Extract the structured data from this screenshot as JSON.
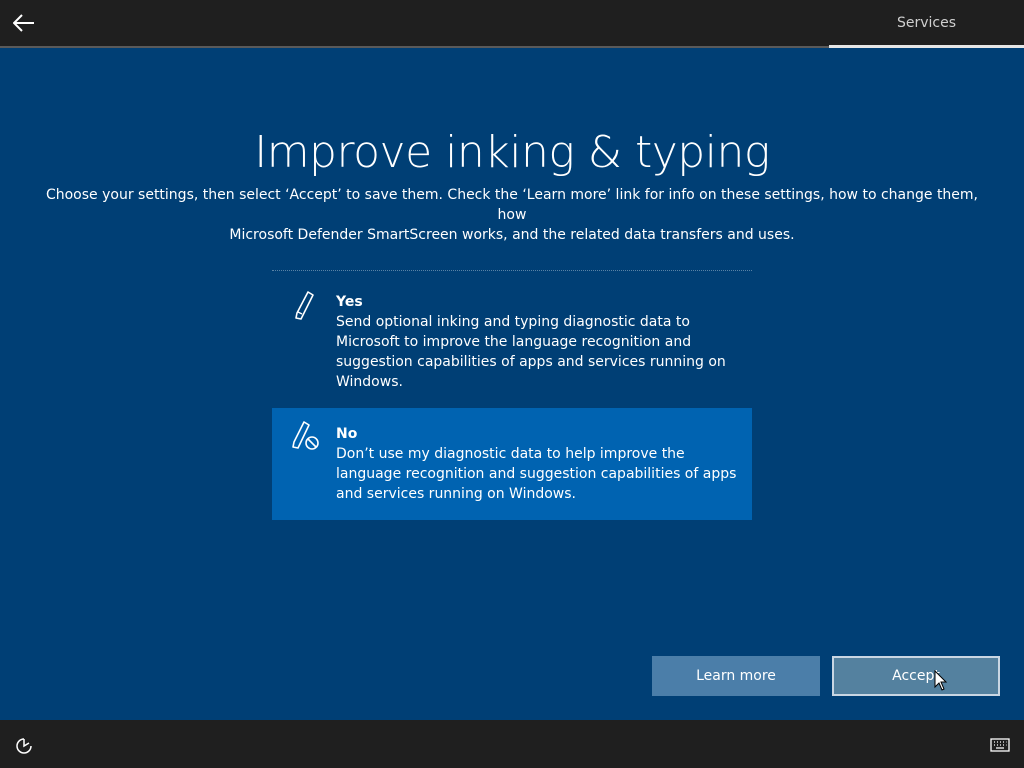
{
  "header": {
    "back_icon": "back-arrow-icon",
    "section": "Services"
  },
  "main": {
    "title": "Improve inking & typing",
    "subtitle_line1": "Choose your settings, then select ‘Accept’ to save them. Check the ‘Learn more’ link for info on these settings, how to change them, how",
    "subtitle_line2": "Microsoft Defender SmartScreen works, and the related data transfers and uses.",
    "options": [
      {
        "icon": "pen-icon",
        "title": "Yes",
        "description": "Send optional inking and typing diagnostic data to Microsoft to improve the language recognition and suggestion capabilities of apps and services running on Windows.",
        "selected": false
      },
      {
        "icon": "pen-blocked-icon",
        "title": "No",
        "description": "Don’t use my diagnostic data to help improve the language recognition and suggestion capabilities of apps and services running on Windows.",
        "selected": true
      }
    ]
  },
  "footer": {
    "learn_more_label": "Learn more",
    "accept_label": "Accept",
    "ease_icon": "ease-of-access-icon",
    "keyboard_icon": "keyboard-icon"
  },
  "colors": {
    "background": "#003f75",
    "selected_option": "#0063b1",
    "bar": "#1f1f1f",
    "button": "#4b7ea9"
  }
}
